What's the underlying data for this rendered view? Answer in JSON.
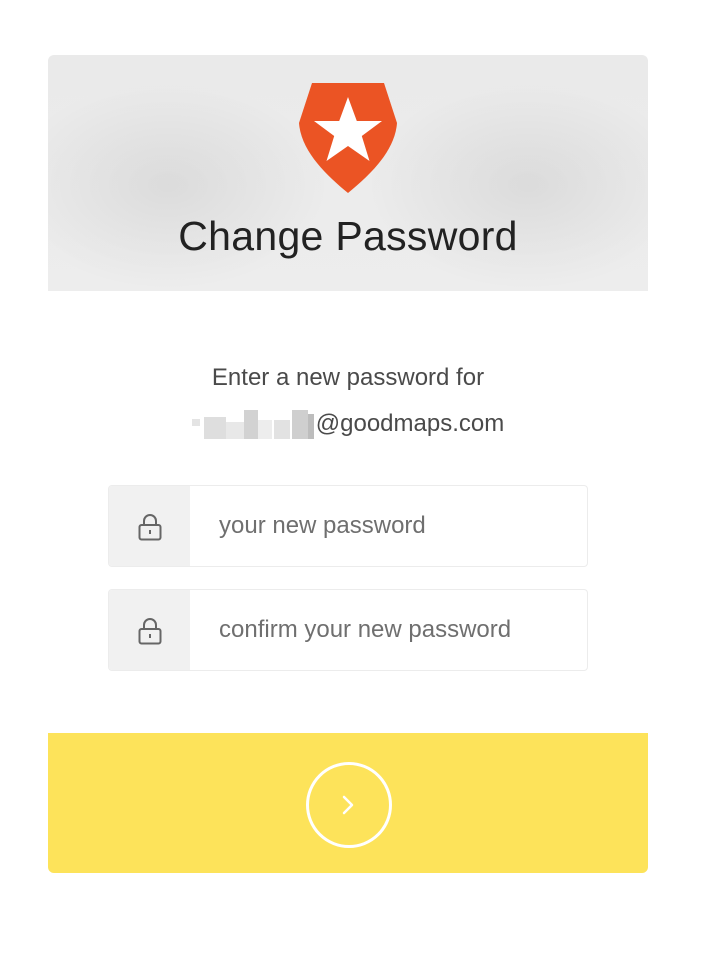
{
  "header": {
    "title": "Change Password",
    "logo_icon": "auth0-shield-star-icon",
    "logo_color": "#eb5424"
  },
  "message": {
    "line1": "Enter a new password for",
    "email_domain": "@goodmaps.com"
  },
  "form": {
    "new_password": {
      "placeholder": "your new password",
      "value": "",
      "icon": "lock-icon"
    },
    "confirm_password": {
      "placeholder": "confirm your new password",
      "value": "",
      "icon": "lock-icon"
    },
    "submit": {
      "icon": "chevron-right-icon",
      "color": "#fde35a"
    }
  }
}
